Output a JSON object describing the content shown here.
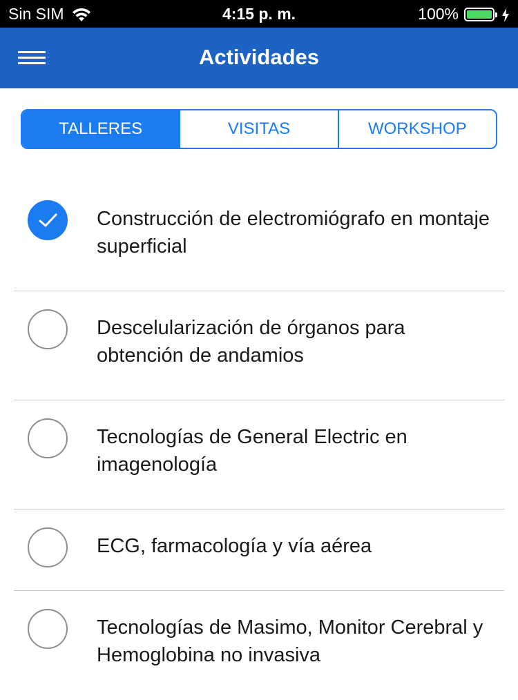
{
  "status_bar": {
    "carrier": "Sin SIM",
    "time": "4:15 p. m.",
    "battery": "100%",
    "battery_level": 1.0,
    "icons": [
      "wifi-icon",
      "battery-icon",
      "charging-bolt-icon"
    ]
  },
  "nav": {
    "title": "Actividades",
    "menu_icon": "hamburger-menu-icon"
  },
  "tabs": [
    {
      "label": "TALLERES",
      "active": true
    },
    {
      "label": "VISITAS",
      "active": false
    },
    {
      "label": "WORKSHOP",
      "active": false
    }
  ],
  "items": [
    {
      "label": "Construcción de electromiógrafo en montaje superficial",
      "checked": true
    },
    {
      "label": "Descelularización de órganos para obtención de andamios",
      "checked": false
    },
    {
      "label": "Tecnologías de General Electric en imagenología",
      "checked": false
    },
    {
      "label": "ECG, farmacología y vía aérea",
      "checked": false
    },
    {
      "label": "Tecnologías de Masimo, Monitor Cerebral y Hemoglobina no invasiva",
      "checked": false
    }
  ],
  "colors": {
    "nav_background": "#1c63c3",
    "accent": "#1b7cf2",
    "battery_fill": "#4cd964"
  }
}
